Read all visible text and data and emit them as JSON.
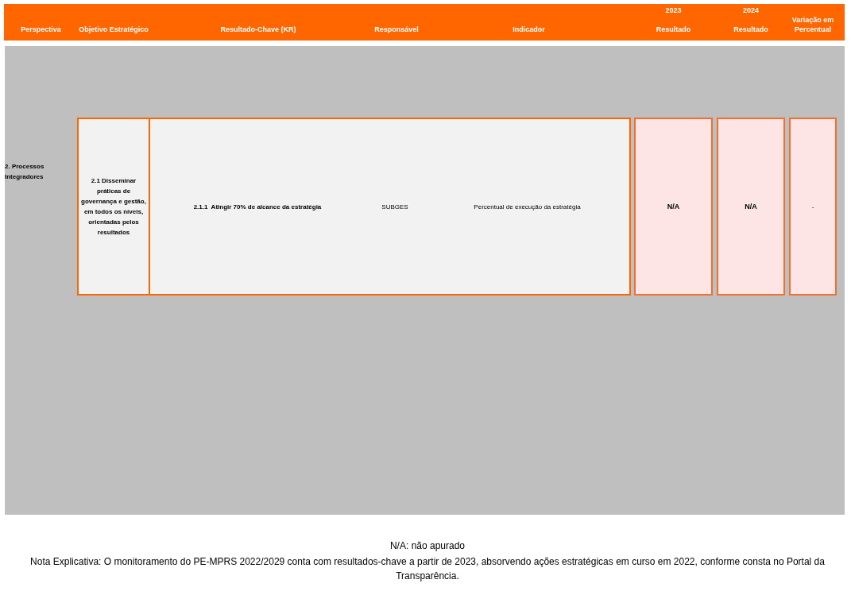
{
  "table": {
    "columns": [
      {
        "label": "Perspectiva"
      },
      {
        "label": "Objetivo Estratégico"
      },
      {
        "label": "Resultado-Chave (KR)"
      },
      {
        "label": "Responsável"
      },
      {
        "label": "Indicador"
      },
      {
        "year": "2023",
        "label": "Resultado"
      },
      {
        "year": "2024",
        "label": "Resultado"
      },
      {
        "label": "Variação em Percentual"
      }
    ],
    "rows": [
      {
        "perspective": "2. Processos Integradores",
        "objective": "2.1 Disseminar práticas de governança e gestão, em todos os níveis, orientadas pelos resultados",
        "key_result": "2.1.1  Atingir 70% de alcance da estratégia",
        "responsible": "SUBGES",
        "indicator": "Percentual de execução da estratégia",
        "result_2023": "N/A",
        "result_2024": "N/A",
        "variation": "-"
      }
    ]
  },
  "notes": [
    "N/A: não apurado",
    "Nota Explicativa: O monitoramento do PE-MPRS 2022/2029 conta com resultados-chave a partir de 2023, absorvendo ações estratégicas em curso em 2022, conforme consta no Portal da Transparência."
  ]
}
